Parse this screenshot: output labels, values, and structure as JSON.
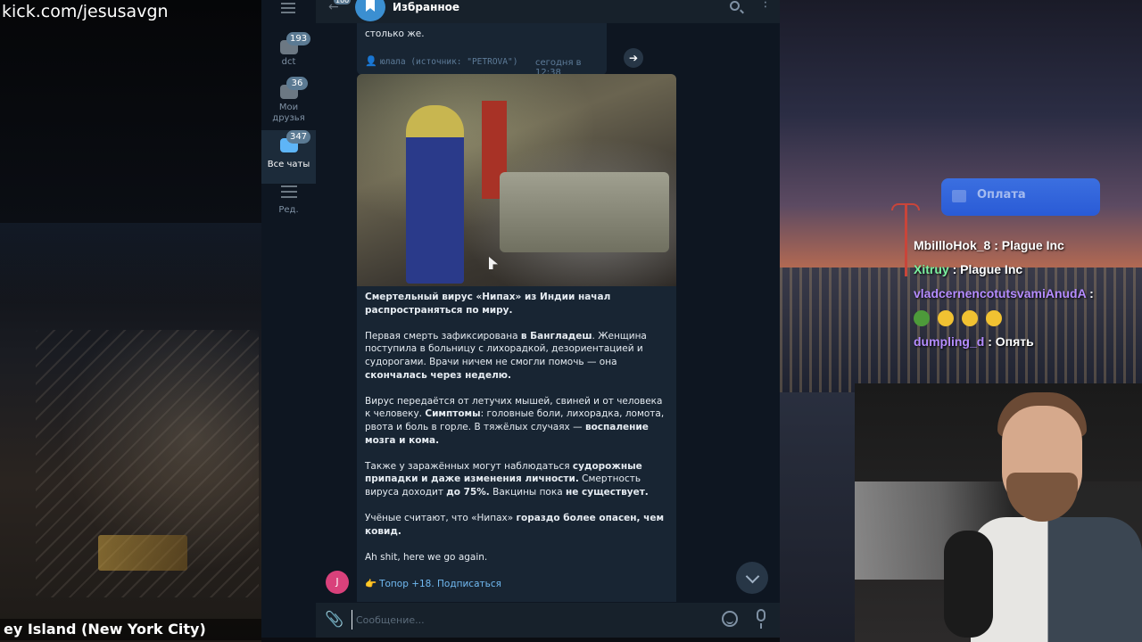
{
  "stream": {
    "url": "kick.com/jesusavgn",
    "location": "ey Island (New York City)"
  },
  "telegram": {
    "folders": [
      {
        "label": "dct",
        "badge": "193"
      },
      {
        "label": "Мои друзья",
        "badge": "36"
      },
      {
        "label": "Все чаты",
        "badge": "347"
      },
      {
        "label": "Ред."
      }
    ],
    "header": {
      "title": "Избранное",
      "back_badge": "100"
    },
    "prev_message": {
      "text": "столько же.",
      "forward_from": "юлала (источник: \"PETROVA\")",
      "time": "сегодня в 12:38"
    },
    "message": {
      "headline": "Смертельный вирус «Нипах» из Индии начал распространяться по миру.",
      "p1_a": "Первая смерть зафиксирована ",
      "p1_b": "в Бангладеш",
      "p1_c": ". Женщина поступила в больницу с лихорадкой, дезориентацией и судорогами. Врачи ничем не смогли помочь — она ",
      "p1_d": "скончалась через неделю.",
      "p2_a": "Вирус передаётся от летучих мышей, свиней и от человека к человеку. ",
      "p2_b": "Симптомы",
      "p2_c": ": головные боли, лихорадка, ломота, рвота и боль в горле. В тяжёлых случаях — ",
      "p2_d": "воспаление мозга и кома.",
      "p3_a": "Также у заражённых могут наблюдаться ",
      "p3_b": "судорожные припадки и даже изменения личности.",
      "p3_c": " Смертность вируса доходит ",
      "p3_d": "до 75%.",
      "p3_e": " Вакцины пока ",
      "p3_f": "не существует.",
      "p4_a": "Учёные считают, что «Нипах» ",
      "p4_b": "гораздо более опасен, чем ковид.",
      "p5": "Ah shit, here we go again.",
      "promo_hand": "👉",
      "promo": "Топор +18. Подписаться"
    },
    "avatar_letter": "J",
    "input_placeholder": "Сообщение..."
  },
  "donation": {
    "label": "Оплата"
  },
  "stream_chat": [
    {
      "user": "MbiIlloHok_8",
      "color": "#ffffff",
      "text": ": Plague Inc"
    },
    {
      "user": "Xitruy",
      "color": "#7cf2a0",
      "text": ": Plague Inc"
    },
    {
      "user": "vladcernencotutsvamiAnudA",
      "color": "#b58cff",
      "text": ":"
    },
    {
      "user": "dumpling_d",
      "color": "#b58cff",
      "text": ": Опять"
    }
  ]
}
